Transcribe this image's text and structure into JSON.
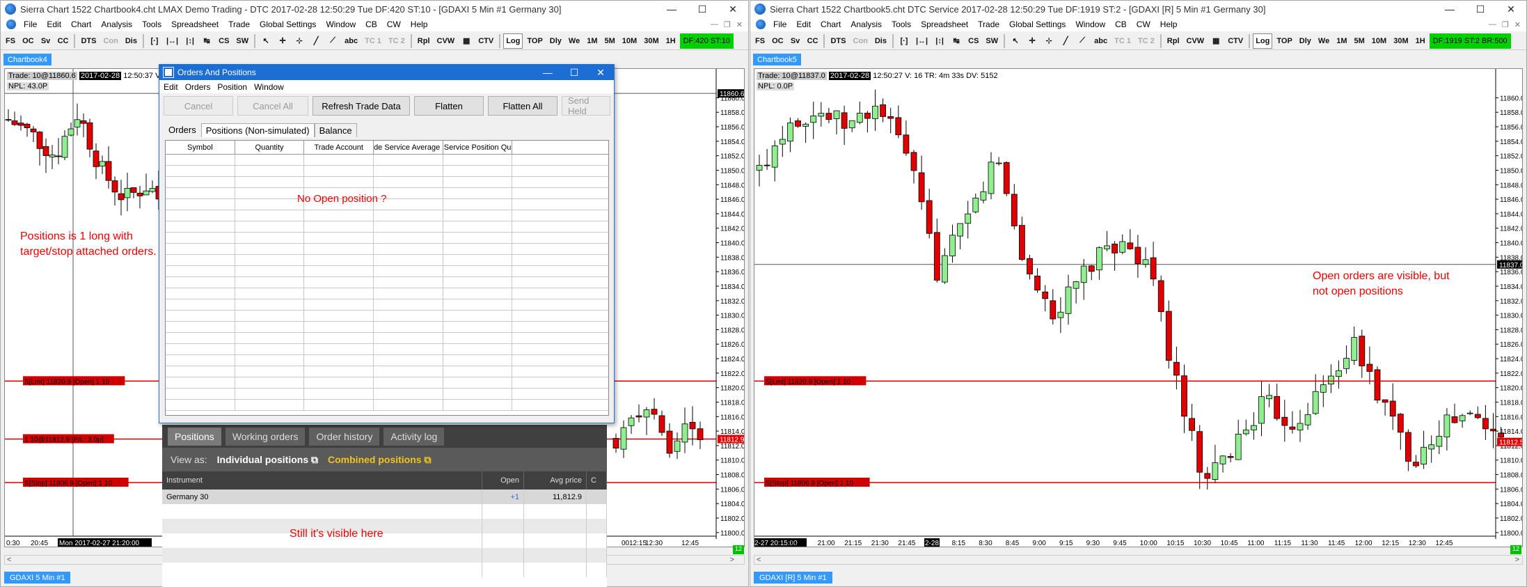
{
  "left": {
    "title": "Sierra Chart 1522 Chartbook4.cht  LMAX Demo Trading - DTC 2017-02-28  12:50:29 Tue DF:420  ST:10 - [GDAXI  5 Min  #1  Germany 30]",
    "menu": [
      "File",
      "Edit",
      "Chart",
      "Analysis",
      "Tools",
      "Spreadsheet",
      "Trade",
      "Global Settings",
      "Window",
      "CB",
      "CW",
      "Help"
    ],
    "status": "DF:420 ST:10",
    "chartbook_tab": "Chartbook4",
    "trade_line": "Trade: 10@11860.6",
    "date": "2017-02-28",
    "time": "12:50:37 V: 5",
    "npl": "NPL: 43.0P",
    "annotation": "Positions is 1 long with target/stop attached orders.",
    "orders": [
      "S[Lmt] 11820.9 [Open] 1  10",
      "1 10@11812.9 [P/L: 3.0p]",
      "S[Stop] 11806.9 [Open] 1  10"
    ],
    "price_current": "11860.6",
    "price_last": "11812.9",
    "x_labels": [
      "0:30",
      "20:45",
      "Mon 2017-02-27 21:20:00",
      "00",
      "12:15",
      "12:30",
      "12:45"
    ],
    "bottom_tab": "GDAXI  5 Min  #1",
    "bottom_tag": "12"
  },
  "right": {
    "title": "Sierra Chart 1522 Chartbook5.cht  DTC Service 2017-02-28  12:50:29 Tue DF:1919  ST:2 - [GDAXI [R]  5 Min  #1  Germany 30]",
    "menu": [
      "File",
      "Edit",
      "Chart",
      "Analysis",
      "Tools",
      "Spreadsheet",
      "Trade",
      "Global Settings",
      "Window",
      "CB",
      "CW",
      "Help"
    ],
    "status": "DF:1919 ST:2 BR:500",
    "chartbook_tab": "Chartbook5",
    "trade_line": "Trade: 10@11837.0",
    "date": "2017-02-28",
    "time": "12:50:27 V: 16  TR: 4m 33s  DV: 5152",
    "npl": "NPL: 0.0P",
    "annotation": "Open orders are visible, but not open positions",
    "orders": [
      "S[Lmt] 11820.9 [Open] 1  10",
      "S[Stop] 11806.9 [Open] 1  10"
    ],
    "price_current": "11837.0",
    "price_last": "11812.5",
    "x_labels": [
      "2-27 20:15:00",
      "0:45",
      "21:00",
      "21:15",
      "21:30",
      "21:45",
      "2-28",
      "8:15",
      "8:30",
      "8:45",
      "9:00",
      "9:15",
      "9:30",
      "9:45",
      "10:00",
      "10:15",
      "10:30",
      "10:45",
      "11:00",
      "11:15",
      "11:30",
      "11:45",
      "12:00",
      "12:15",
      "12:30",
      "12:45"
    ],
    "bottom_tab": "GDAXI [R]  5 Min  #1",
    "bottom_tag": "12"
  },
  "toolbar": [
    "FS",
    "OC",
    "Sv",
    "CC",
    "DTS",
    "Con",
    "Dis",
    "CS",
    "SW",
    "abc",
    "TC 1",
    "TC 2",
    "Rpl",
    "CVW",
    "CTV",
    "Log",
    "TOP",
    "Dly",
    "We",
    "1M",
    "5M",
    "10M",
    "30M",
    "1H"
  ],
  "y_ticks": [
    "11860.0",
    "11858.0",
    "11856.0",
    "11854.0",
    "11852.0",
    "11850.0",
    "11848.0",
    "11846.0",
    "11844.0",
    "11842.0",
    "11840.0",
    "11838.0",
    "11836.0",
    "11834.0",
    "11832.0",
    "11830.0",
    "11828.0",
    "11826.0",
    "11824.0",
    "11822.0",
    "11820.0",
    "11818.0",
    "11816.0",
    "11814.0",
    "11812.0",
    "11810.0",
    "11808.0",
    "11806.0",
    "11804.0",
    "11802.0",
    "11800.0"
  ],
  "dialog": {
    "title": "Orders And Positions",
    "menu": [
      "Edit",
      "Orders",
      "Position",
      "Window"
    ],
    "buttons": {
      "cancel": "Cancel",
      "cancel_all": "Cancel All",
      "refresh": "Refresh Trade Data",
      "flatten": "Flatten",
      "flatten_all": "Flatten All",
      "send_held": "Send Held"
    },
    "tabs": {
      "orders": "Orders",
      "positions": "Positions (Non-simulated)",
      "balance": "Balance"
    },
    "columns": [
      "Symbol",
      "Quantity",
      "Trade Account",
      "de Service Average P",
      "Service Position Qu",
      ""
    ],
    "note": "No Open position ?"
  },
  "lmax": {
    "tabs": [
      "Positions",
      "Working orders",
      "Order history",
      "Activity log"
    ],
    "view_as": "View as:",
    "individual": "Individual positions",
    "combined": "Combined positions",
    "columns": [
      "Instrument",
      "Open",
      "Avg price",
      "C"
    ],
    "row": {
      "instrument": "Germany 30",
      "open": "+1",
      "avg": "11,812.9"
    },
    "note": "Still it's visible here"
  },
  "colors": {
    "up": "#90ee90",
    "down": "#e00000",
    "accent": "#3399ff",
    "status": "#00d000",
    "order_line": "#d00000"
  }
}
